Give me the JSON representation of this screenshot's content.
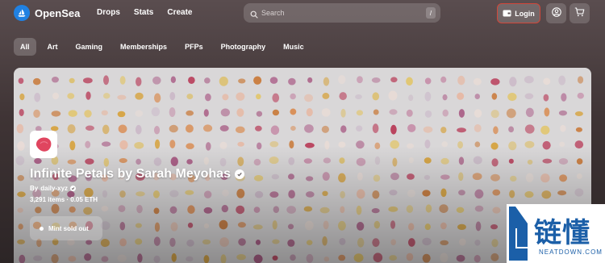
{
  "brand": {
    "name": "OpenSea",
    "accent": "#2081e2"
  },
  "nav": {
    "items": [
      "Drops",
      "Stats",
      "Create"
    ]
  },
  "search": {
    "placeholder": "Search",
    "shortcut": "/"
  },
  "header": {
    "login_label": "Login",
    "login_border": "#d1473a",
    "icons": [
      "profile-icon",
      "cart-icon"
    ]
  },
  "categories": {
    "items": [
      "All",
      "Art",
      "Gaming",
      "Memberships",
      "PFPs",
      "Photography",
      "Music"
    ],
    "active": "All"
  },
  "hero": {
    "title": "Infinite Petals by Sarah Meyohas",
    "creator_prefix": "By",
    "creator": "daily-xyz",
    "stats": "3,291 items · 0.05 ETH",
    "mint_label": "Mint sold out"
  },
  "watermark": {
    "main": "链懂",
    "sub": "NEATDOWN.COM"
  }
}
